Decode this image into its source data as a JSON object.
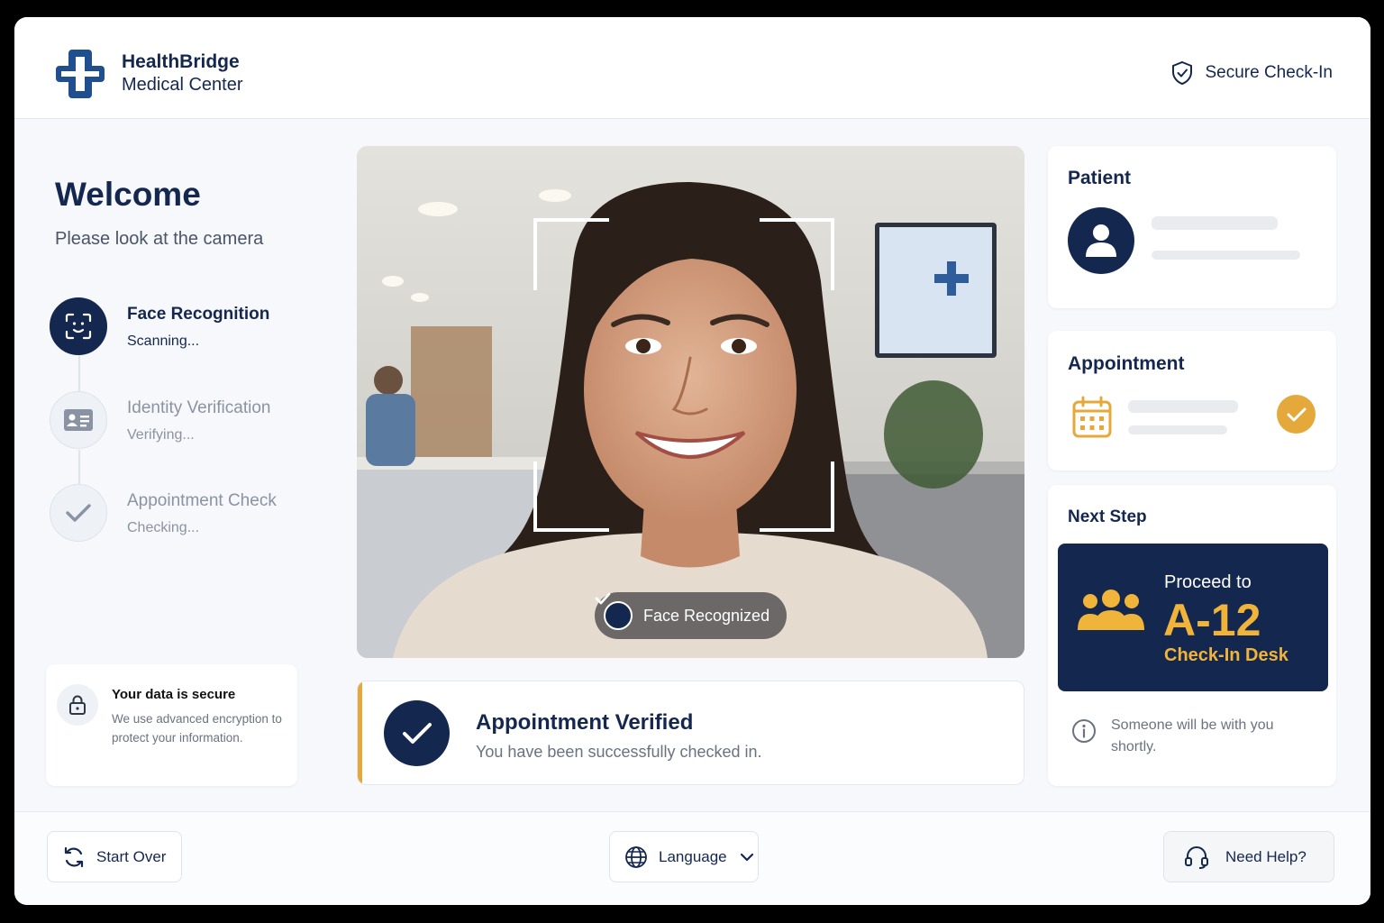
{
  "header": {
    "brand_name": "HealthBridge",
    "brand_sub": "Medical Center",
    "secure_label": "Secure Check-In"
  },
  "left": {
    "welcome": "Welcome",
    "subtitle": "Please look at the camera",
    "steps": [
      {
        "title": "Face Recognition",
        "status": "Scanning...",
        "icon": "face-scan-icon",
        "active": true
      },
      {
        "title": "Identity Verification",
        "status": "Verifying...",
        "icon": "id-card-icon",
        "active": false
      },
      {
        "title": "Appointment Check",
        "status": "Checking...",
        "icon": "check-icon",
        "active": false
      }
    ],
    "secure_card": {
      "title": "Your data is secure",
      "text": "We use advanced encryption to protect your information."
    }
  },
  "camera": {
    "badge": "Face Recognized"
  },
  "verified": {
    "title": "Appointment Verified",
    "text": "You have been successfully checked in."
  },
  "right": {
    "patient_title": "Patient",
    "appointment_title": "Appointment",
    "next_step_title": "Next Step",
    "proceed_to": "Proceed to",
    "desk_code": "A-12",
    "desk_label": "Check-In Desk",
    "info": "Someone will be with you shortly."
  },
  "footer": {
    "start_over": "Start Over",
    "language": "Language",
    "help": "Need Help?"
  },
  "colors": {
    "navy": "#14274e",
    "gold": "#e4a93a",
    "background": "#f7f8fb"
  }
}
